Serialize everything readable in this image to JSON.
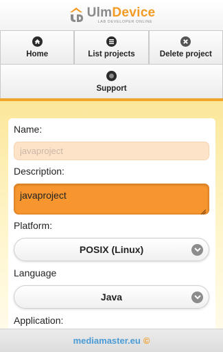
{
  "header": {
    "brand_part1": "Ulm",
    "brand_part2": "Device",
    "tagline": "LAB DEVELOPER ONLINE",
    "logo_icon": "ud-logo-icon"
  },
  "nav": {
    "items": [
      {
        "label": "Home",
        "icon": "home-icon"
      },
      {
        "label": "List projects",
        "icon": "list-icon"
      },
      {
        "label": "Delete project",
        "icon": "delete-icon"
      },
      {
        "label": "Support",
        "icon": "support-icon"
      }
    ]
  },
  "form": {
    "name_label": "Name:",
    "name_value": "javaproject",
    "description_label": "Description:",
    "description_value": "javaproject",
    "platform_label": "Platform:",
    "platform_value": "POSIX (Linux)",
    "language_label": "Language",
    "language_value": "Java",
    "application_label": "Application:"
  },
  "footer": {
    "site": "mediamaster.eu",
    "copyright": "©"
  },
  "colors": {
    "accent": "#f7962f",
    "brand_orange": "#f39a22",
    "link_blue": "#4a9bd6"
  }
}
